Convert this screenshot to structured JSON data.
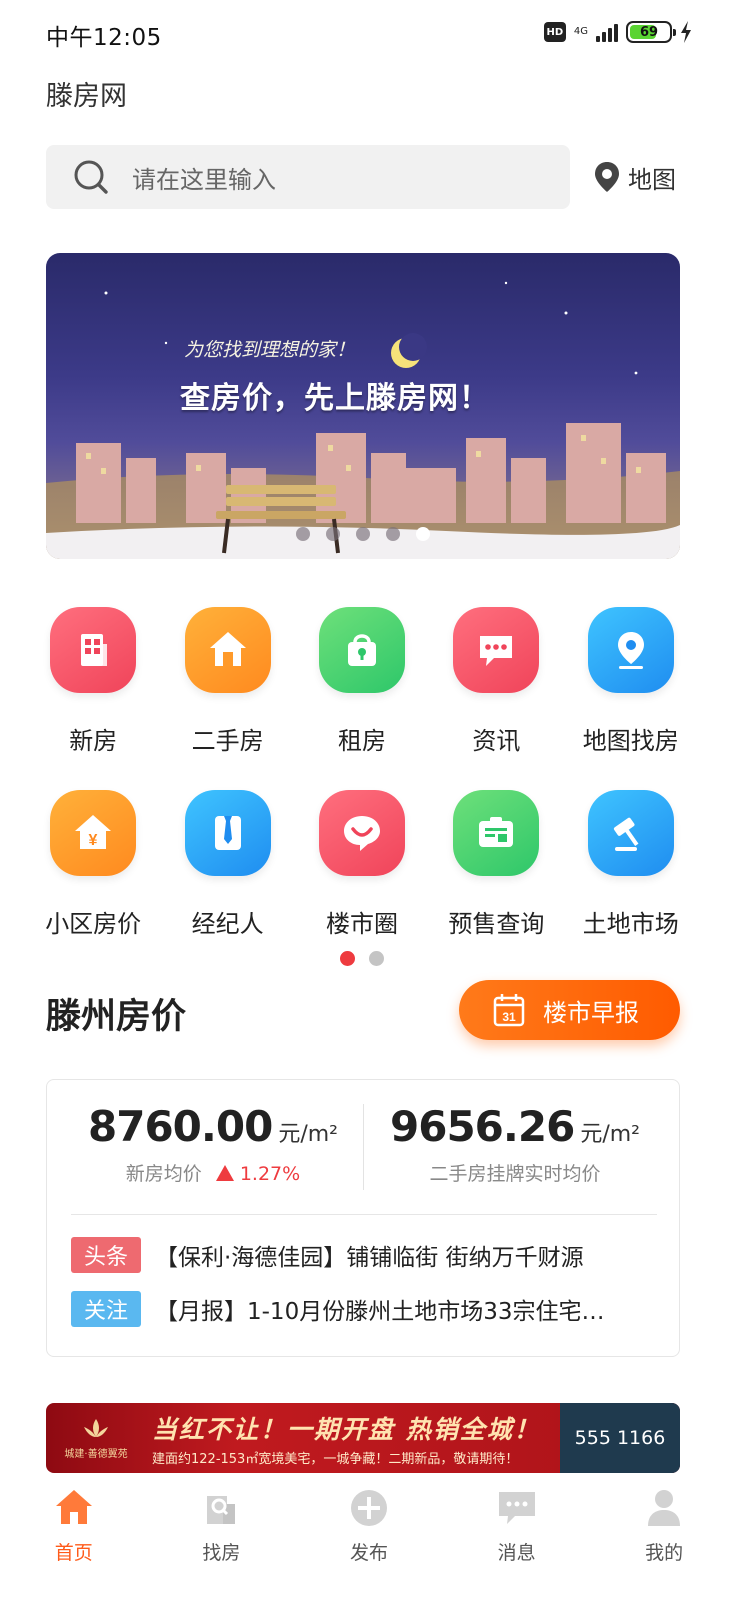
{
  "status_bar": {
    "time": "中午12:05",
    "hd": "HD",
    "network": "4G",
    "battery": "69",
    "battery_level": 0.69
  },
  "app": {
    "title": "滕房网"
  },
  "search": {
    "placeholder": "请在这里输入",
    "map_label": "地图"
  },
  "banner": {
    "subtitle": "为您找到理想的家！",
    "headline": "查房价，先上滕房网！",
    "slide_count": 5,
    "active_slide": 5
  },
  "categories": [
    {
      "label": "新房",
      "icon": "building-icon",
      "color_from": "#ff6f7e",
      "color_to": "#f0445a"
    },
    {
      "label": "二手房",
      "icon": "house-icon",
      "color_from": "#ffb13a",
      "color_to": "#ff8a1f"
    },
    {
      "label": "租房",
      "icon": "lock-bag-icon",
      "color_from": "#6ee07a",
      "color_to": "#2ec76a"
    },
    {
      "label": "资讯",
      "icon": "chat-icon",
      "color_from": "#ff6f7e",
      "color_to": "#f0445a"
    },
    {
      "label": "地图找房",
      "icon": "map-pin-icon",
      "color_from": "#3fc4ff",
      "color_to": "#1f8df0"
    },
    {
      "label": "小区房价",
      "icon": "yuan-house-icon",
      "color_from": "#ffb13a",
      "color_to": "#ff8a1f"
    },
    {
      "label": "经纪人",
      "icon": "tie-icon",
      "color_from": "#3fc4ff",
      "color_to": "#1f8df0"
    },
    {
      "label": "楼市圈",
      "icon": "smile-chat-icon",
      "color_from": "#ff6f7e",
      "color_to": "#f0445a"
    },
    {
      "label": "预售查询",
      "icon": "ticket-icon",
      "color_from": "#6ee07a",
      "color_to": "#2ec76a"
    },
    {
      "label": "土地市场",
      "icon": "gavel-icon",
      "color_from": "#3fc4ff",
      "color_to": "#1f8df0"
    }
  ],
  "grid_pages": {
    "count": 2,
    "active": 1
  },
  "prices": {
    "title": "滕州房价",
    "report_button": "楼市早报",
    "calendar_day": "31",
    "new_price": "8760.00",
    "new_unit": "元/m²",
    "new_caption": "新房均价",
    "new_change": "1.27%",
    "second_price": "9656.26",
    "second_unit": "元/m²",
    "second_caption": "二手房挂牌实时均价"
  },
  "news": [
    {
      "tag": "头条",
      "text": "【保利·海德佳园】铺铺临街 街纳万千财源"
    },
    {
      "tag": "关注",
      "text": "【月报】1-10月份滕州土地市场33宗住宅…"
    }
  ],
  "ad": {
    "brand": "城建·善德翼苑",
    "headline": "当红不让！一期开盘 热销全城！",
    "sub": "建面约122-153㎡宽境美宅，一城争藏！二期新品，敬请期待！",
    "phone": "555 1166"
  },
  "tabs": [
    {
      "label": "首页",
      "icon": "home-icon",
      "active": true
    },
    {
      "label": "找房",
      "icon": "find-house-icon",
      "active": false
    },
    {
      "label": "发布",
      "icon": "plus-circle-icon",
      "active": false
    },
    {
      "label": "消息",
      "icon": "message-icon",
      "active": false
    },
    {
      "label": "我的",
      "icon": "person-icon",
      "active": false
    }
  ],
  "colors": {
    "accent": "#ff5b1a",
    "red": "#ee3b3f",
    "tag_red": "#ee6a70",
    "tag_blue": "#5ab8f0"
  }
}
